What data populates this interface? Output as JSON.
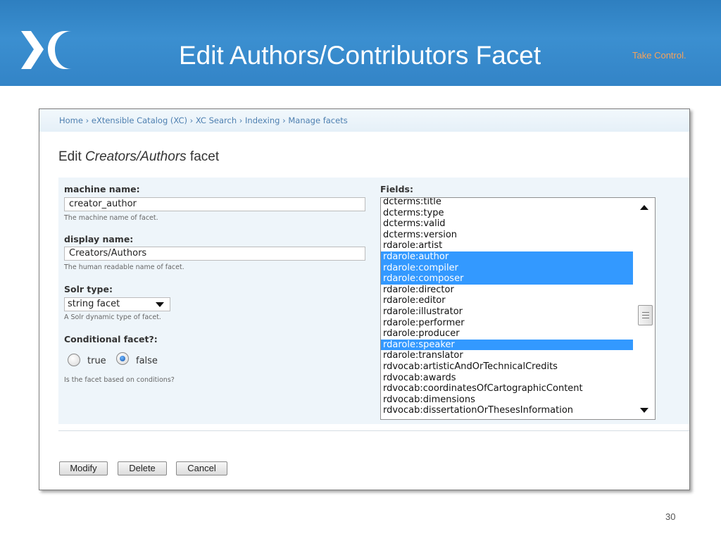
{
  "slide": {
    "title": "Edit Authors/Contributors Facet",
    "tagline": "Take Control.",
    "page_number": "30",
    "brand_color": "#3384c7",
    "tagline_color": "#f6a25a"
  },
  "breadcrumb": "Home › eXtensible Catalog (XC) › XC Search › Indexing › Manage facets",
  "form": {
    "title_prefix": "Edit ",
    "title_italic": "Creators/Authors",
    "title_suffix": " facet",
    "machine_name": {
      "label": "machine name:",
      "value": "creator_author",
      "hint": "The machine name of facet."
    },
    "display_name": {
      "label": "display name:",
      "value": "Creators/Authors",
      "hint": "The human readable name of facet."
    },
    "solr_type": {
      "label": "Solr type:",
      "value": "string facet",
      "hint": "A Solr dynamic type of facet."
    },
    "conditional": {
      "label": "Conditional facet?:",
      "true_label": "true",
      "false_label": "false",
      "selected": "false",
      "hint": "Is the facet based on conditions?"
    },
    "fields": {
      "label": "Fields:",
      "options": [
        {
          "text": "dcterms:title",
          "selected": false
        },
        {
          "text": "dcterms:type",
          "selected": false
        },
        {
          "text": "dcterms:valid",
          "selected": false
        },
        {
          "text": "dcterms:version",
          "selected": false
        },
        {
          "text": "rdarole:artist",
          "selected": false
        },
        {
          "text": "rdarole:author",
          "selected": true
        },
        {
          "text": "rdarole:compiler",
          "selected": true
        },
        {
          "text": "rdarole:composer",
          "selected": true
        },
        {
          "text": "rdarole:director",
          "selected": false
        },
        {
          "text": "rdarole:editor",
          "selected": false
        },
        {
          "text": "rdarole:illustrator",
          "selected": false
        },
        {
          "text": "rdarole:performer",
          "selected": false
        },
        {
          "text": "rdarole:producer",
          "selected": false
        },
        {
          "text": "rdarole:speaker",
          "selected": true
        },
        {
          "text": "rdarole:translator",
          "selected": false
        },
        {
          "text": "rdvocab:artisticAndOrTechnicalCredits",
          "selected": false
        },
        {
          "text": "rdvocab:awards",
          "selected": false
        },
        {
          "text": "rdvocab:coordinatesOfCartographicContent",
          "selected": false
        },
        {
          "text": "rdvocab:dimensions",
          "selected": false
        },
        {
          "text": "rdvocab:dissertationOrThesesInformation",
          "selected": false
        }
      ]
    },
    "buttons": {
      "modify": "Modify",
      "delete": "Delete",
      "cancel": "Cancel"
    }
  },
  "icons": {
    "logo": "xc-logo-icon",
    "dropdown": "chevron-down-icon",
    "scroll_up": "arrow-up-icon",
    "scroll_down": "arrow-down-icon"
  }
}
